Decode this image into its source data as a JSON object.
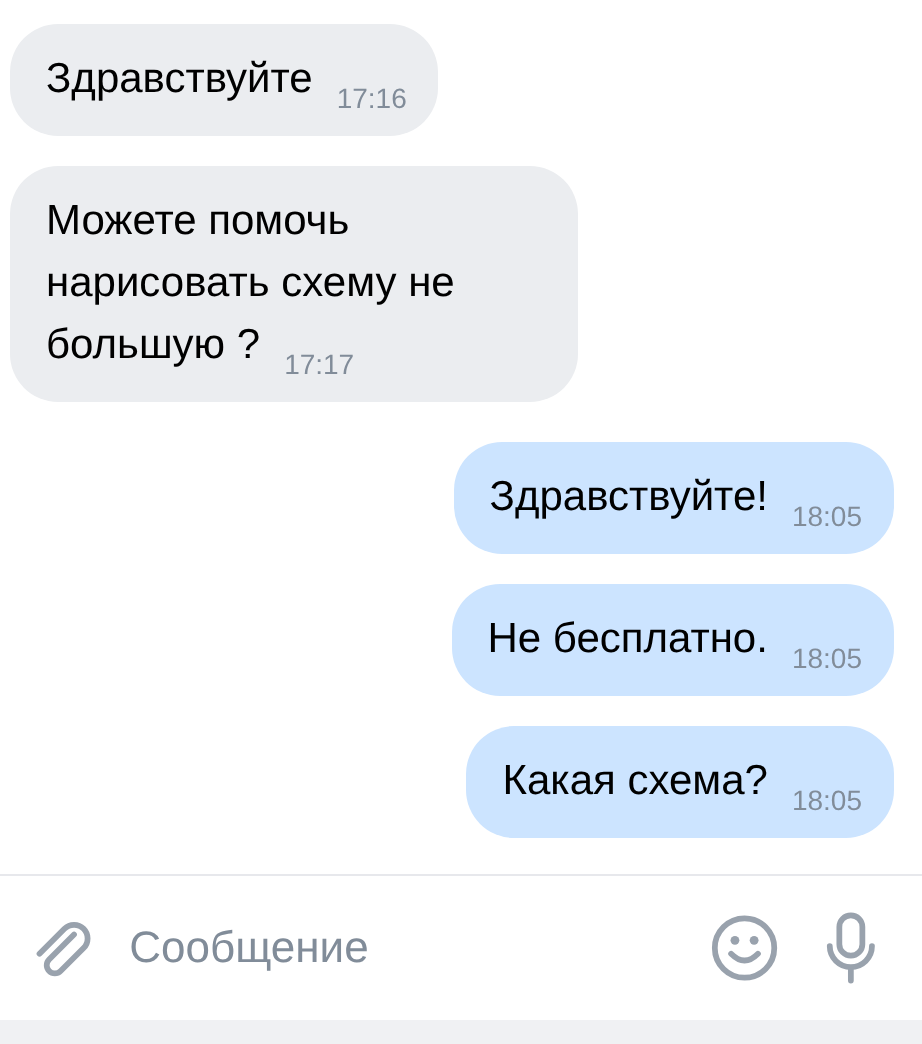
{
  "messages": [
    {
      "kind": "incoming",
      "text": "Здравствуйте",
      "time": "17:16"
    },
    {
      "kind": "incoming",
      "text": "Можете помочь нарисовать схему не большую ?",
      "time": "17:17"
    },
    {
      "kind": "outgoing",
      "text": "Здравствуйте!",
      "time": "18:05"
    },
    {
      "kind": "outgoing",
      "text": "Не бесплатно.",
      "time": "18:05"
    },
    {
      "kind": "outgoing",
      "text": "Какая схема?",
      "time": "18:05"
    }
  ],
  "composer": {
    "placeholder": "Сообщение"
  }
}
